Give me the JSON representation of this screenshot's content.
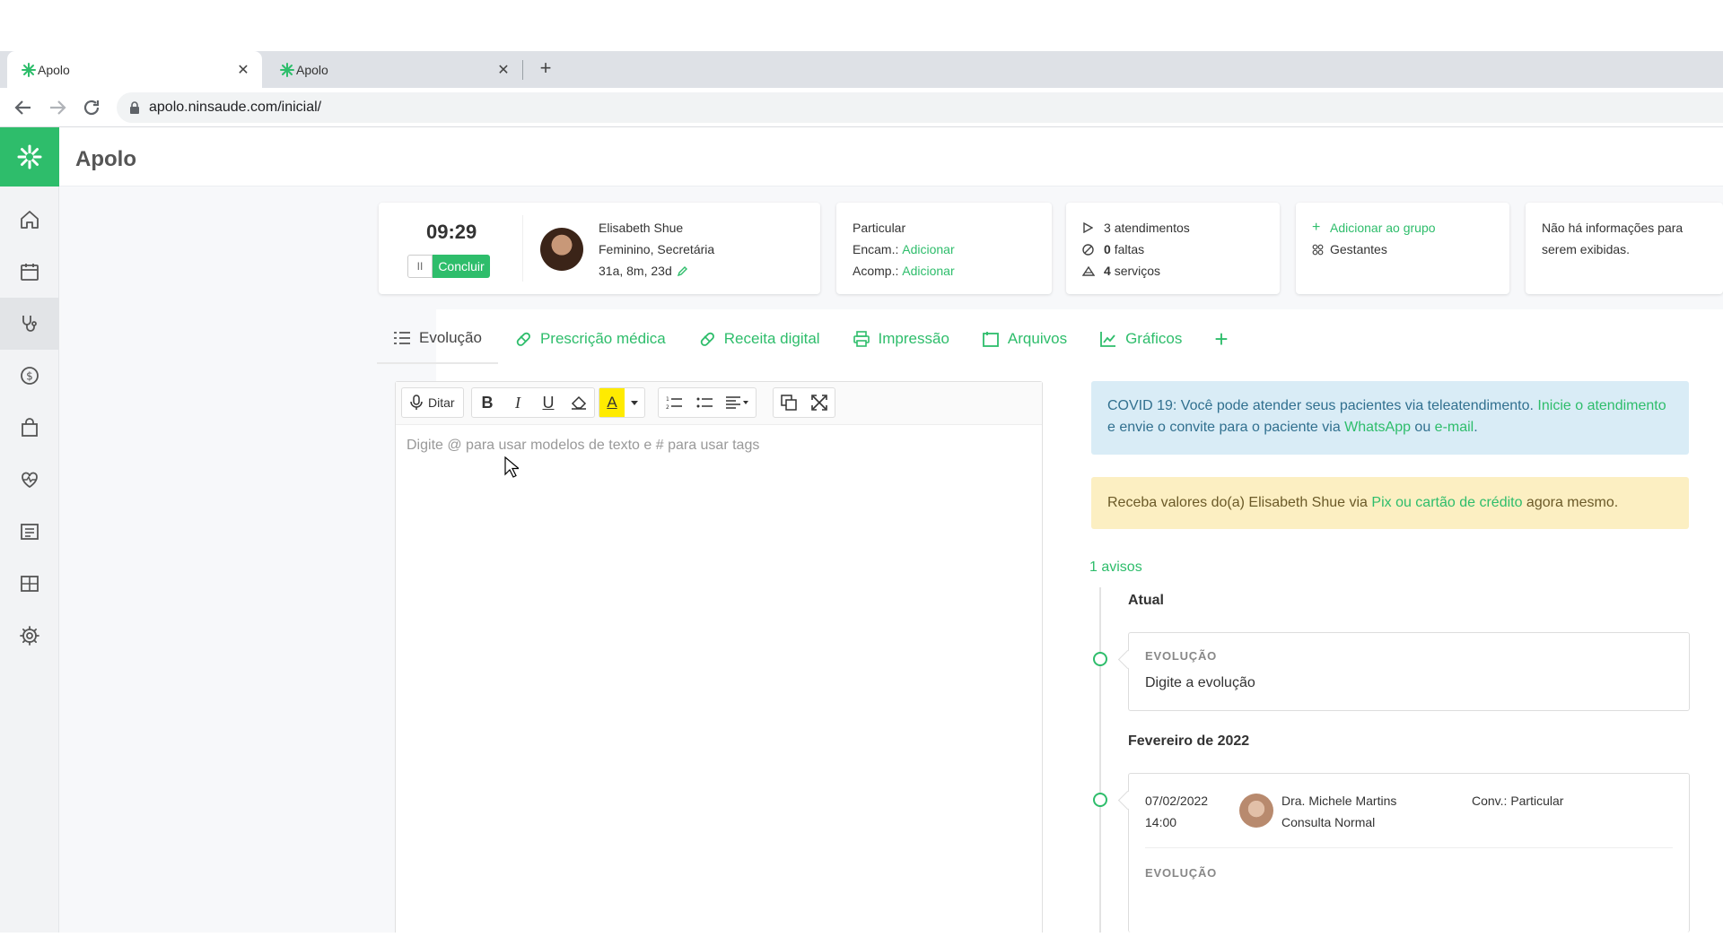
{
  "browser": {
    "tabs": [
      {
        "title": "Apolo",
        "active": true
      },
      {
        "title": "Apolo",
        "active": false
      }
    ],
    "new_tab": "+",
    "close_glyph": "✕",
    "url": "apolo.ninsaude.com/inicial/"
  },
  "app": {
    "title": "Apolo",
    "brand_color": "#2ebd6b"
  },
  "sidebar": {
    "items": [
      {
        "icon": "home-icon"
      },
      {
        "icon": "calendar-icon"
      },
      {
        "icon": "stethoscope-icon",
        "active": true
      },
      {
        "icon": "dollar-icon"
      },
      {
        "icon": "shopping-bag-icon"
      },
      {
        "icon": "heartbeat-icon"
      },
      {
        "icon": "document-list-icon"
      },
      {
        "icon": "grid-icon"
      },
      {
        "icon": "gear-icon"
      }
    ]
  },
  "session": {
    "timer": "09:29",
    "pause_glyph": "II",
    "finish_label": "Concluir"
  },
  "patient": {
    "name": "Elisabeth Shue",
    "details": "Feminino, Secretária",
    "age": "31a, 8m, 23d"
  },
  "insurance": {
    "plan": "Particular",
    "referral_label": "Encam.:",
    "referral_action": "Adicionar",
    "companion_label": "Acomp.:",
    "companion_action": "Adicionar"
  },
  "stats": {
    "appointments_count": "3",
    "appointments_label": "atendimentos",
    "absences_count": "0",
    "absences_label": "faltas",
    "services_count": "4",
    "services_label": "serviços"
  },
  "groups": {
    "add_label": "Adicionar ao grupo",
    "group_name": "Gestantes"
  },
  "info_card": {
    "line1": "Não há informações para",
    "line2": "serem exibidas."
  },
  "tabs": [
    {
      "label": "Evolução",
      "icon": "list-icon",
      "active": true
    },
    {
      "label": "Prescrição médica",
      "icon": "pill-icon"
    },
    {
      "label": "Receita digital",
      "icon": "pill-icon"
    },
    {
      "label": "Impressão",
      "icon": "printer-icon"
    },
    {
      "label": "Arquivos",
      "icon": "folder-icon"
    },
    {
      "label": "Gráficos",
      "icon": "chart-icon"
    }
  ],
  "add_tab": "+",
  "editor": {
    "dictate_label": "Ditar",
    "bold": "B",
    "italic": "I",
    "underline": "U",
    "highlight": "A",
    "placeholder": "Digite @ para usar modelos de texto e # para usar tags"
  },
  "covid_alert": {
    "text1": "COVID 19: Você pode atender seus pacientes via teleatendimento. ",
    "link1": "Inicie o atendimento",
    "text2": " e envie o convite para o paciente via ",
    "link2": "WhatsApp",
    "text3": " ou ",
    "link3": "e-mail",
    "text4": "."
  },
  "payment_alert": {
    "text1": "Receba valores do(a) Elisabeth Shue via ",
    "link": "Pix ou cartão de crédito",
    "text2": " agora mesmo."
  },
  "timeline": {
    "notices": "1 avisos",
    "current_heading": "Atual",
    "current_label": "EVOLUÇÃO",
    "current_placeholder": "Digite a evolução",
    "month_heading": "Fevereiro de 2022",
    "entry": {
      "date": "07/02/2022",
      "time": "14:00",
      "doctor": "Dra. Michele Martins",
      "type": "Consulta Normal",
      "agreement": "Conv.: Particular",
      "section_label": "EVOLUÇÃO"
    }
  }
}
